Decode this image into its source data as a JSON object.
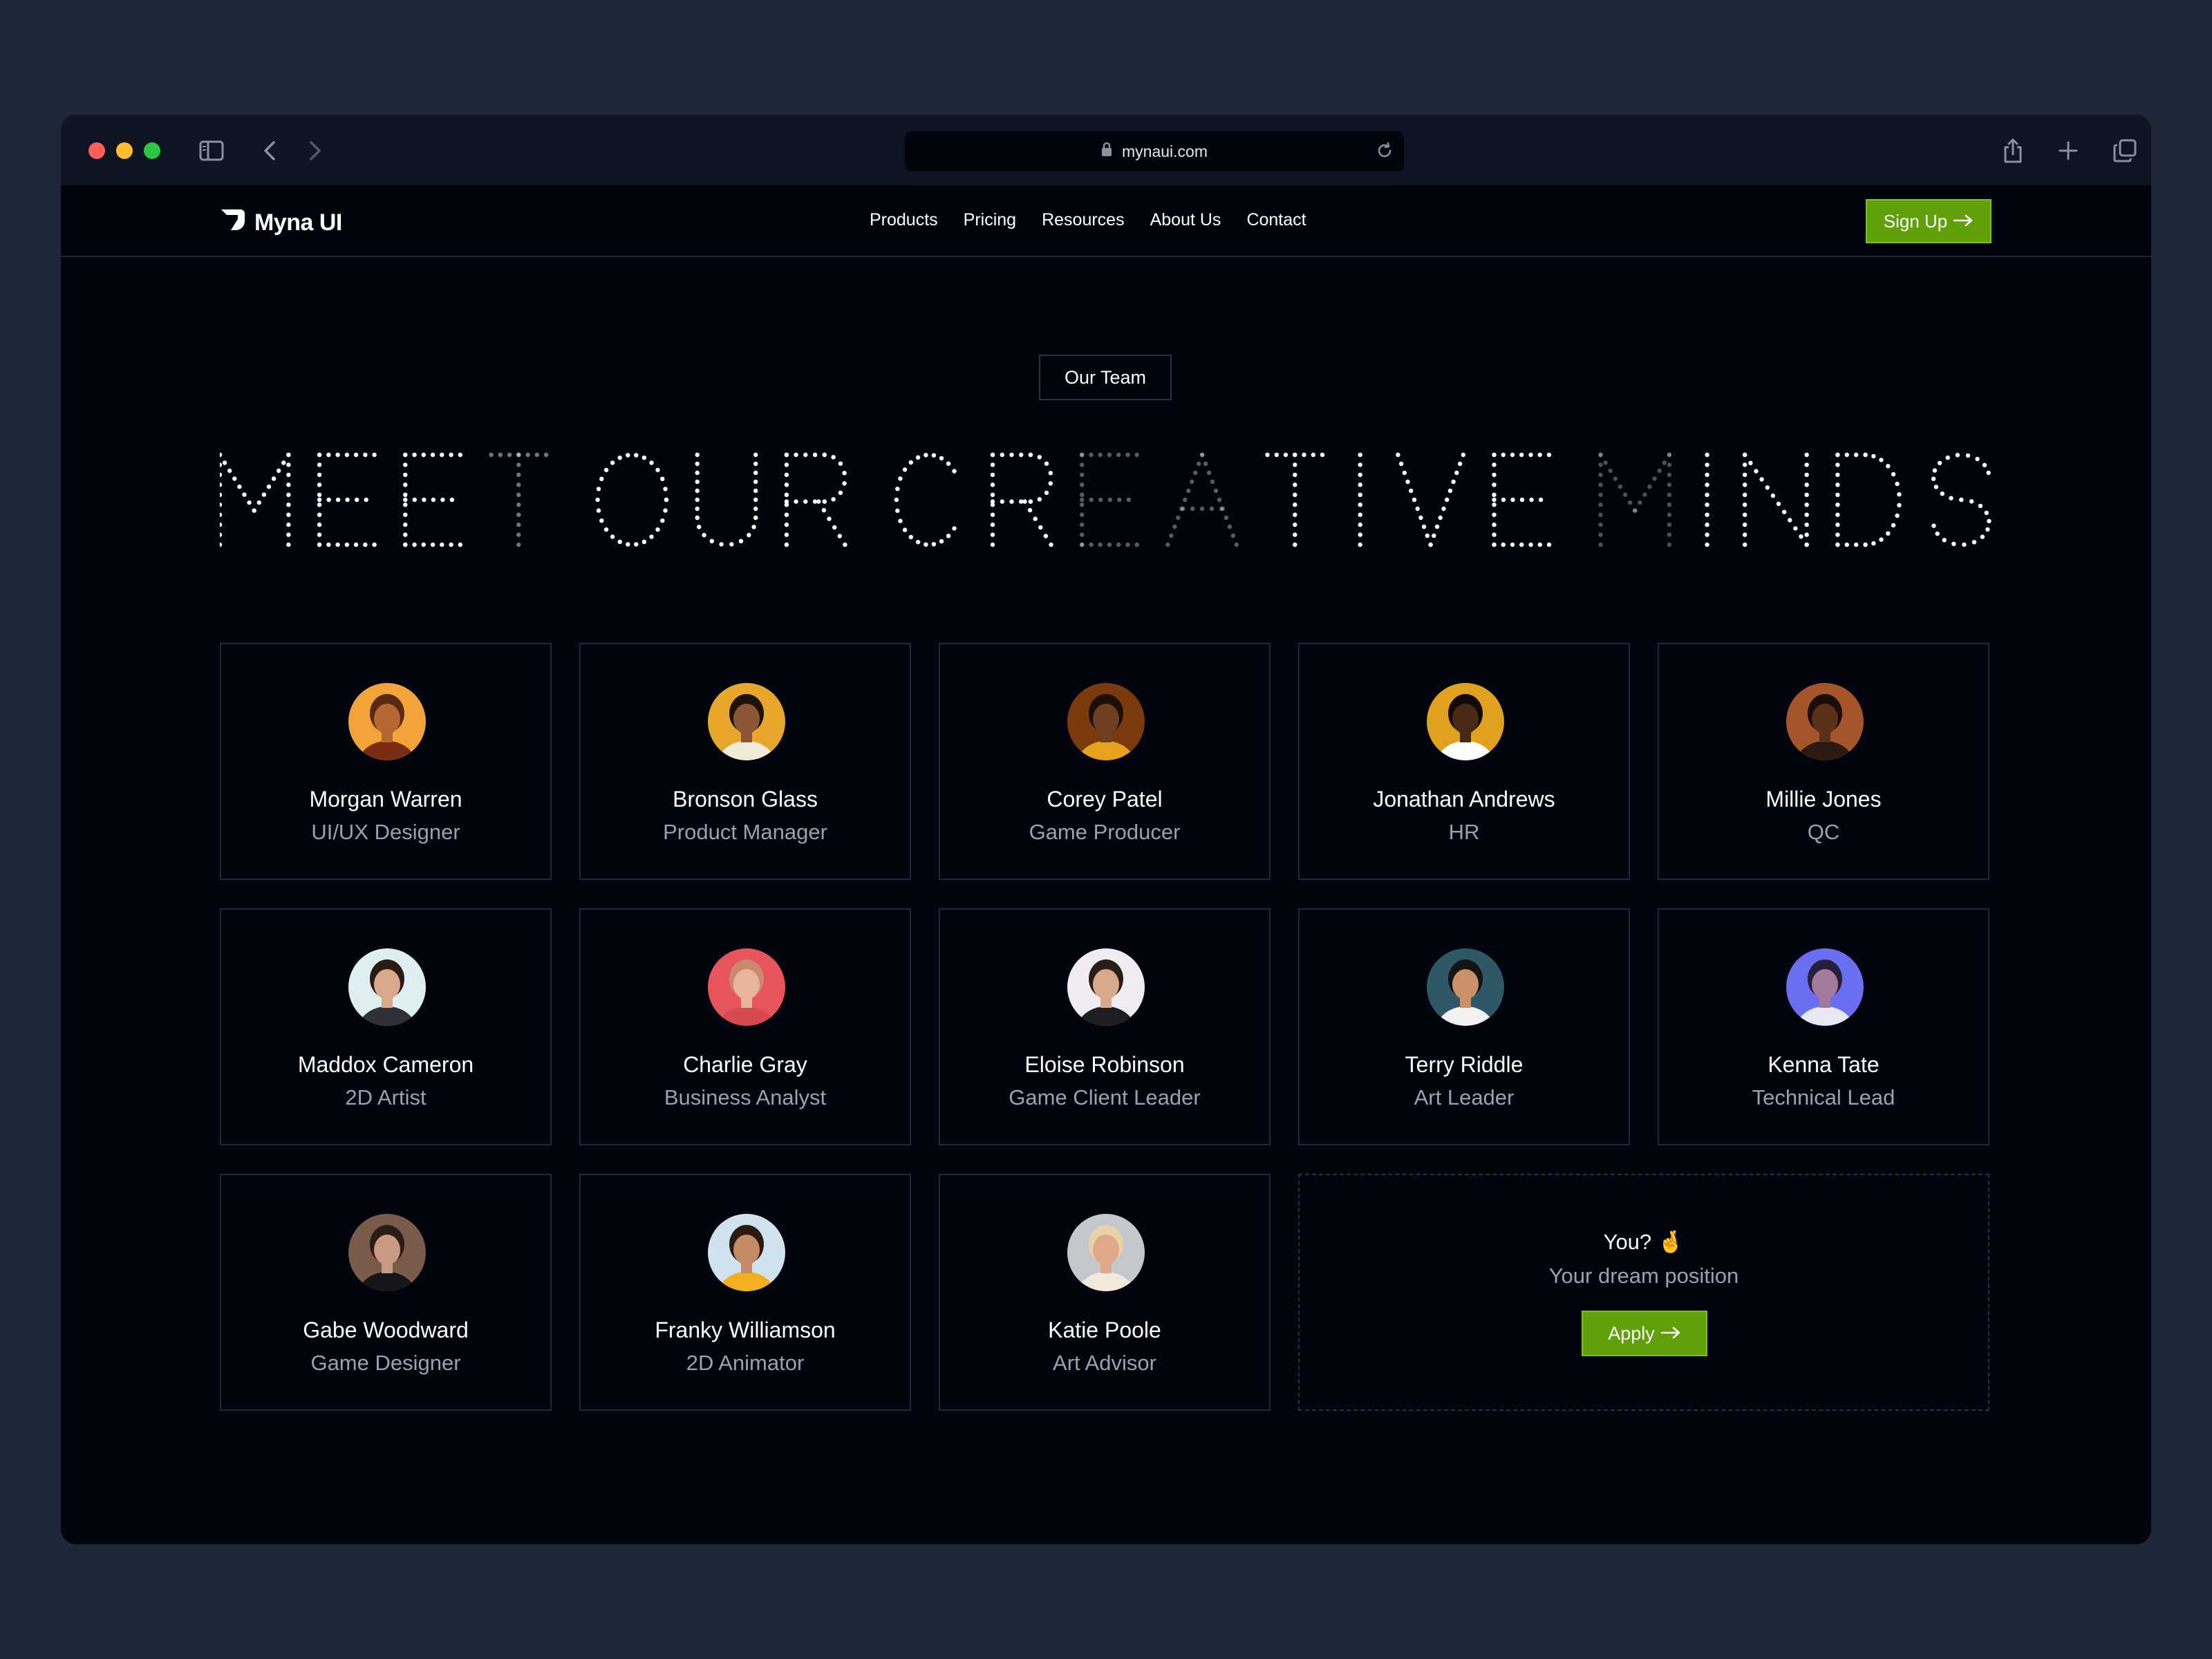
{
  "browser": {
    "url": "mynaui.com",
    "traffic_colors": [
      "#ff5f57",
      "#febc2e",
      "#28c840"
    ]
  },
  "nav": {
    "logo_text": "Myna UI",
    "menu": [
      "Products",
      "Pricing",
      "Resources",
      "About Us",
      "Contact"
    ],
    "cta_label": "Sign Up"
  },
  "hero": {
    "badge": "Our Team",
    "headline": "MEET OUR CREATIVE MINDS"
  },
  "team": [
    {
      "name": "Morgan Warren",
      "role": "UI/UX Designer",
      "bg": "#f2a33a",
      "skin": "#b5682f",
      "hair": "#5a2a10",
      "shirt": "#7a2d12"
    },
    {
      "name": "Bronson Glass",
      "role": "Product Manager",
      "bg": "#e6a72a",
      "skin": "#8a5634",
      "hair": "#1e120a",
      "shirt": "#f0ead8"
    },
    {
      "name": "Corey Patel",
      "role": "Game Producer",
      "bg": "#7a3a0c",
      "skin": "#6e3f21",
      "hair": "#1b0f08",
      "shirt": "#e6a21c"
    },
    {
      "name": "Jonathan Andrews",
      "role": "HR",
      "bg": "#e0a11e",
      "skin": "#4a2a16",
      "hair": "#120a06",
      "shirt": "#ffffff"
    },
    {
      "name": "Millie Jones",
      "role": "QC",
      "bg": "#a4552a",
      "skin": "#5a3018",
      "hair": "#1a0e08",
      "shirt": "#2a1a12"
    },
    {
      "name": "Maddox Cameron",
      "role": "2D Artist",
      "bg": "#dfeef0",
      "skin": "#d9a98a",
      "hair": "#2a1c14",
      "shirt": "#2e3238"
    },
    {
      "name": "Charlie Gray",
      "role": "Business Analyst",
      "bg": "#e8545c",
      "skin": "#e8b49a",
      "hair": "#c98a70",
      "shirt": "#d84a52"
    },
    {
      "name": "Eloise Robinson",
      "role": "Game Client Leader",
      "bg": "#f0ecf2",
      "skin": "#d8a88a",
      "hair": "#2a1e18",
      "shirt": "#1e1e22"
    },
    {
      "name": "Terry Riddle",
      "role": "Art Leader",
      "bg": "#2e5866",
      "skin": "#c9906a",
      "hair": "#141414",
      "shirt": "#f2f2f2"
    },
    {
      "name": "Kenna Tate",
      "role": "Technical Lead",
      "bg": "#6a6ef0",
      "skin": "#a47a9a",
      "hair": "#24203a",
      "shirt": "#e8e8f4"
    },
    {
      "name": "Gabe Woodward",
      "role": "Game Designer",
      "bg": "#7a5a4a",
      "skin": "#c89a82",
      "hair": "#2a1c16",
      "shirt": "#16161a"
    },
    {
      "name": "Franky Williamson",
      "role": "2D Animator",
      "bg": "#cfe2ee",
      "skin": "#c48a66",
      "hair": "#2a1a10",
      "shirt": "#f2b01e"
    },
    {
      "name": "Katie Poole",
      "role": "Art Advisor",
      "bg": "#c4c8cc",
      "skin": "#e0a888",
      "hair": "#e8d2a8",
      "shirt": "#f2e8dc"
    }
  ],
  "join": {
    "title": "You? 🤞",
    "subtitle": "Your dream position",
    "cta_label": "Apply"
  },
  "colors": {
    "accent": "#5fa00b",
    "background": "#03050e",
    "card_border": "#222838",
    "muted_text": "#9ca1ad"
  }
}
